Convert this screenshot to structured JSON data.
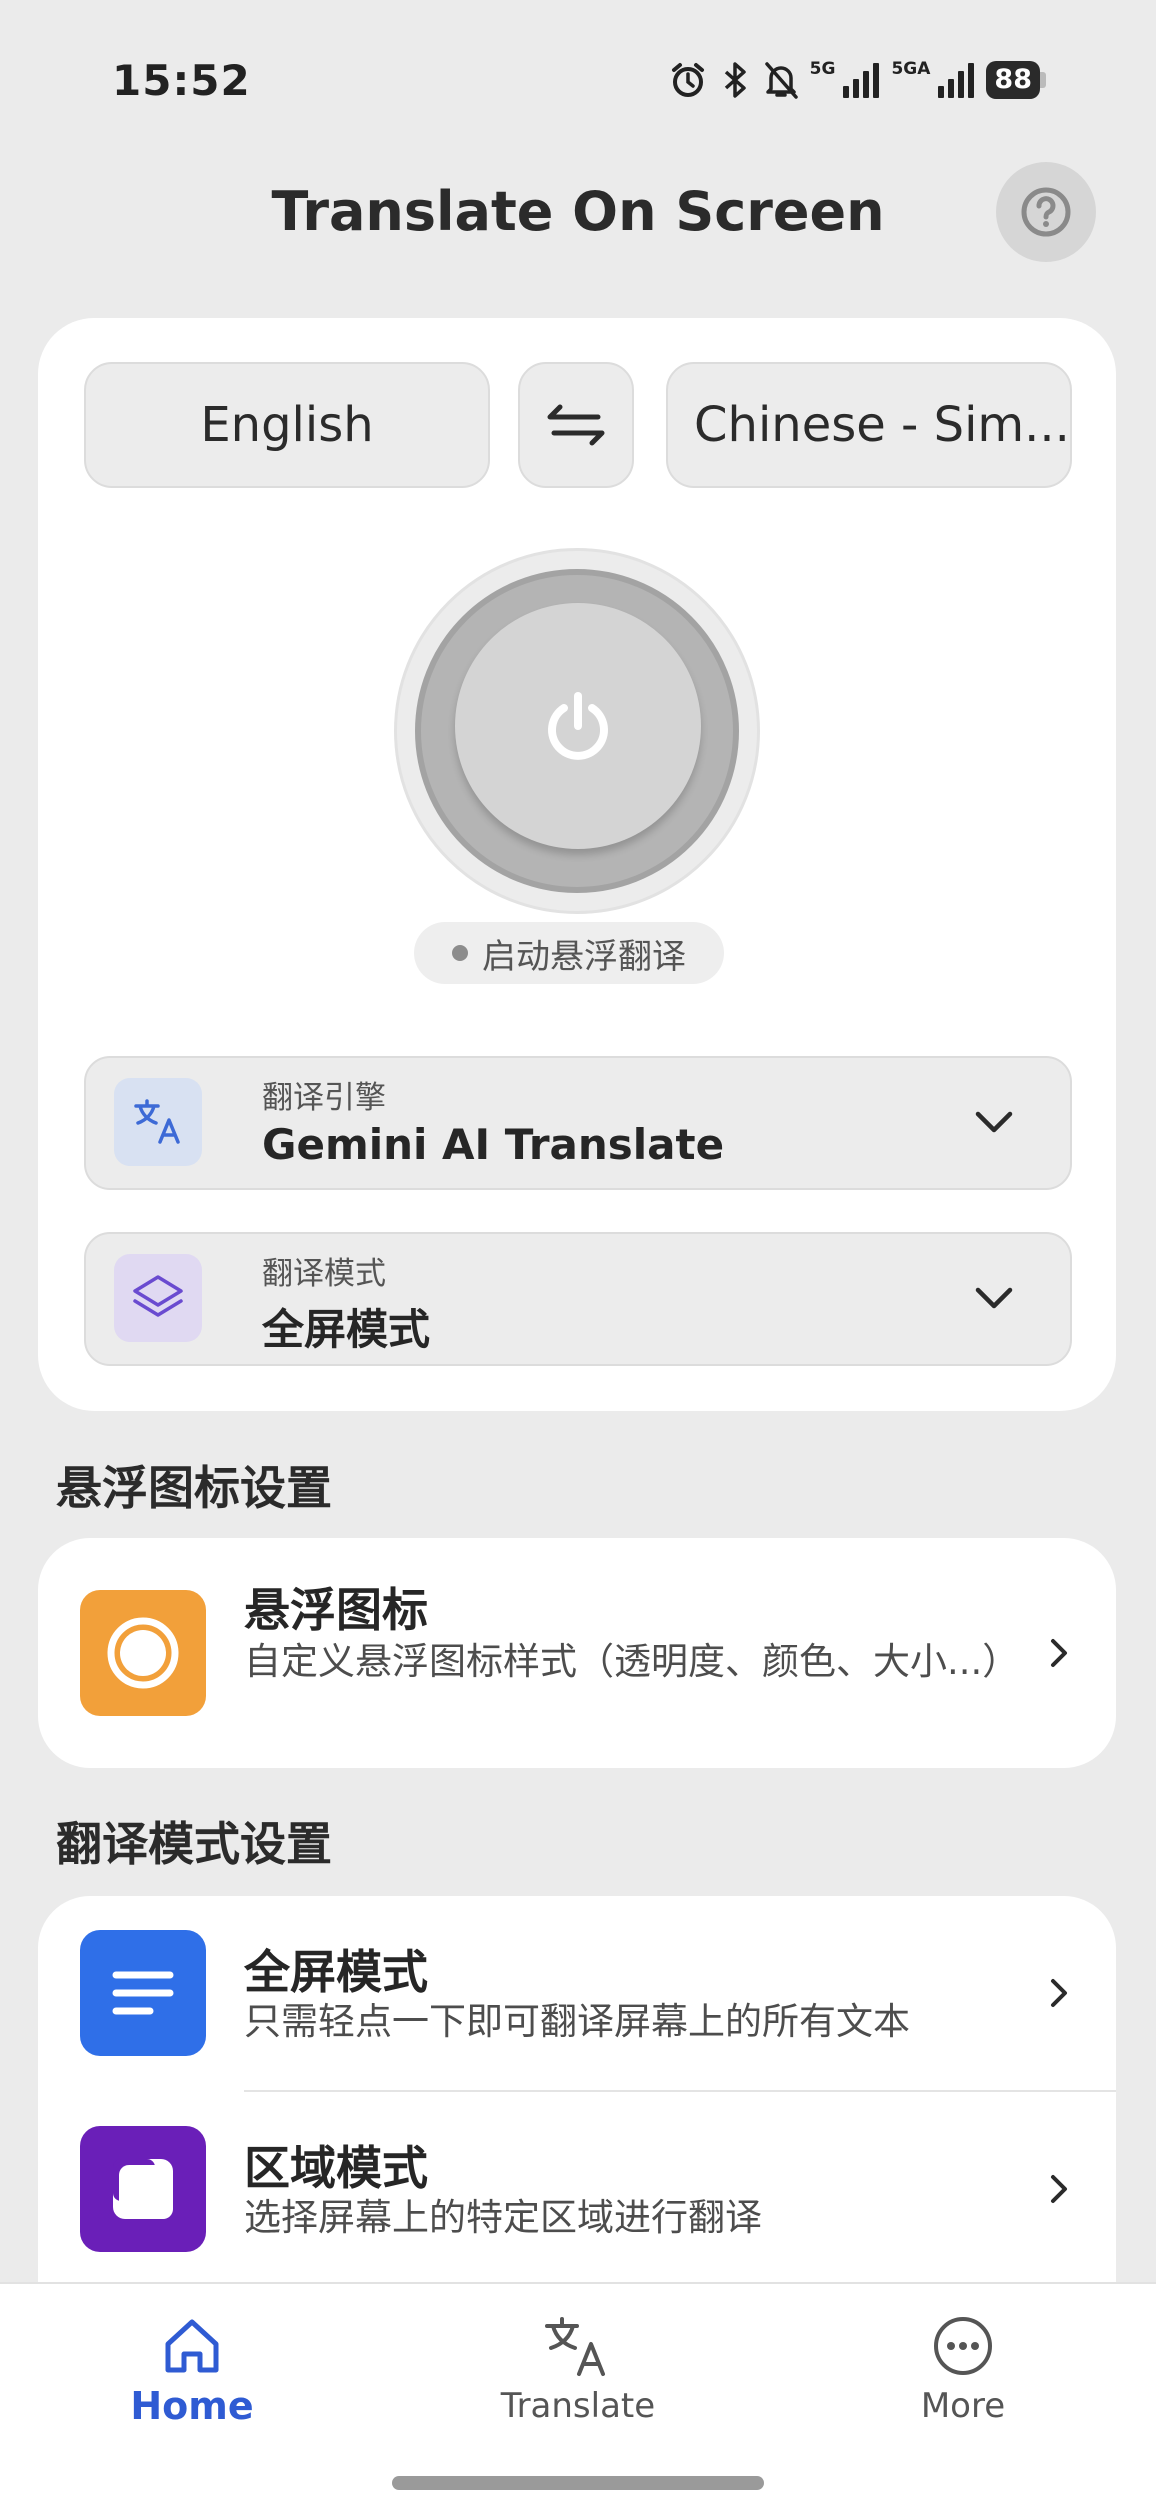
{
  "status_bar": {
    "time": "15:52",
    "network1": "5G",
    "network2": "5GA",
    "battery": "88",
    "icons": [
      "alarm-icon",
      "bluetooth-icon",
      "bell-off-icon",
      "signal-icon",
      "signal-icon",
      "battery-icon"
    ]
  },
  "header": {
    "title": "Translate On Screen",
    "help_icon": "help-circle-icon"
  },
  "languages": {
    "source": "English",
    "target": "Chinese - Sim...",
    "swap_icon": "swap-arrows-icon"
  },
  "power": {
    "icon": "power-icon",
    "status_text": "启动悬浮翻译"
  },
  "engine": {
    "label": "翻译引擎",
    "value": "Gemini AI Translate",
    "icon": "translate-icon"
  },
  "mode": {
    "label": "翻译模式",
    "value": "全屏模式",
    "icon": "layers-icon"
  },
  "floating_section": {
    "title": "悬浮图标设置",
    "items": [
      {
        "title": "悬浮图标",
        "desc": "自定义悬浮图标样式（透明度、颜色、大小...）",
        "icon": "floating-circle-icon",
        "color": "#f2a03a"
      }
    ]
  },
  "modes_section": {
    "title": "翻译模式设置",
    "items": [
      {
        "title": "全屏模式",
        "desc": "只需轻点一下即可翻译屏幕上的所有文本",
        "icon": "lines-icon",
        "color": "#2f6fe8"
      },
      {
        "title": "区域模式",
        "desc": "选择屏幕上的特定区域进行翻译",
        "icon": "region-icon",
        "color": "#6a1fb8"
      }
    ]
  },
  "bottom_nav": {
    "items": [
      {
        "label": "Home",
        "icon": "home-icon",
        "active": true
      },
      {
        "label": "Translate",
        "icon": "translate-icon",
        "active": false
      },
      {
        "label": "More",
        "icon": "more-icon",
        "active": false
      }
    ]
  },
  "colors": {
    "accent": "#2f5bd3",
    "background": "#ebebeb"
  }
}
